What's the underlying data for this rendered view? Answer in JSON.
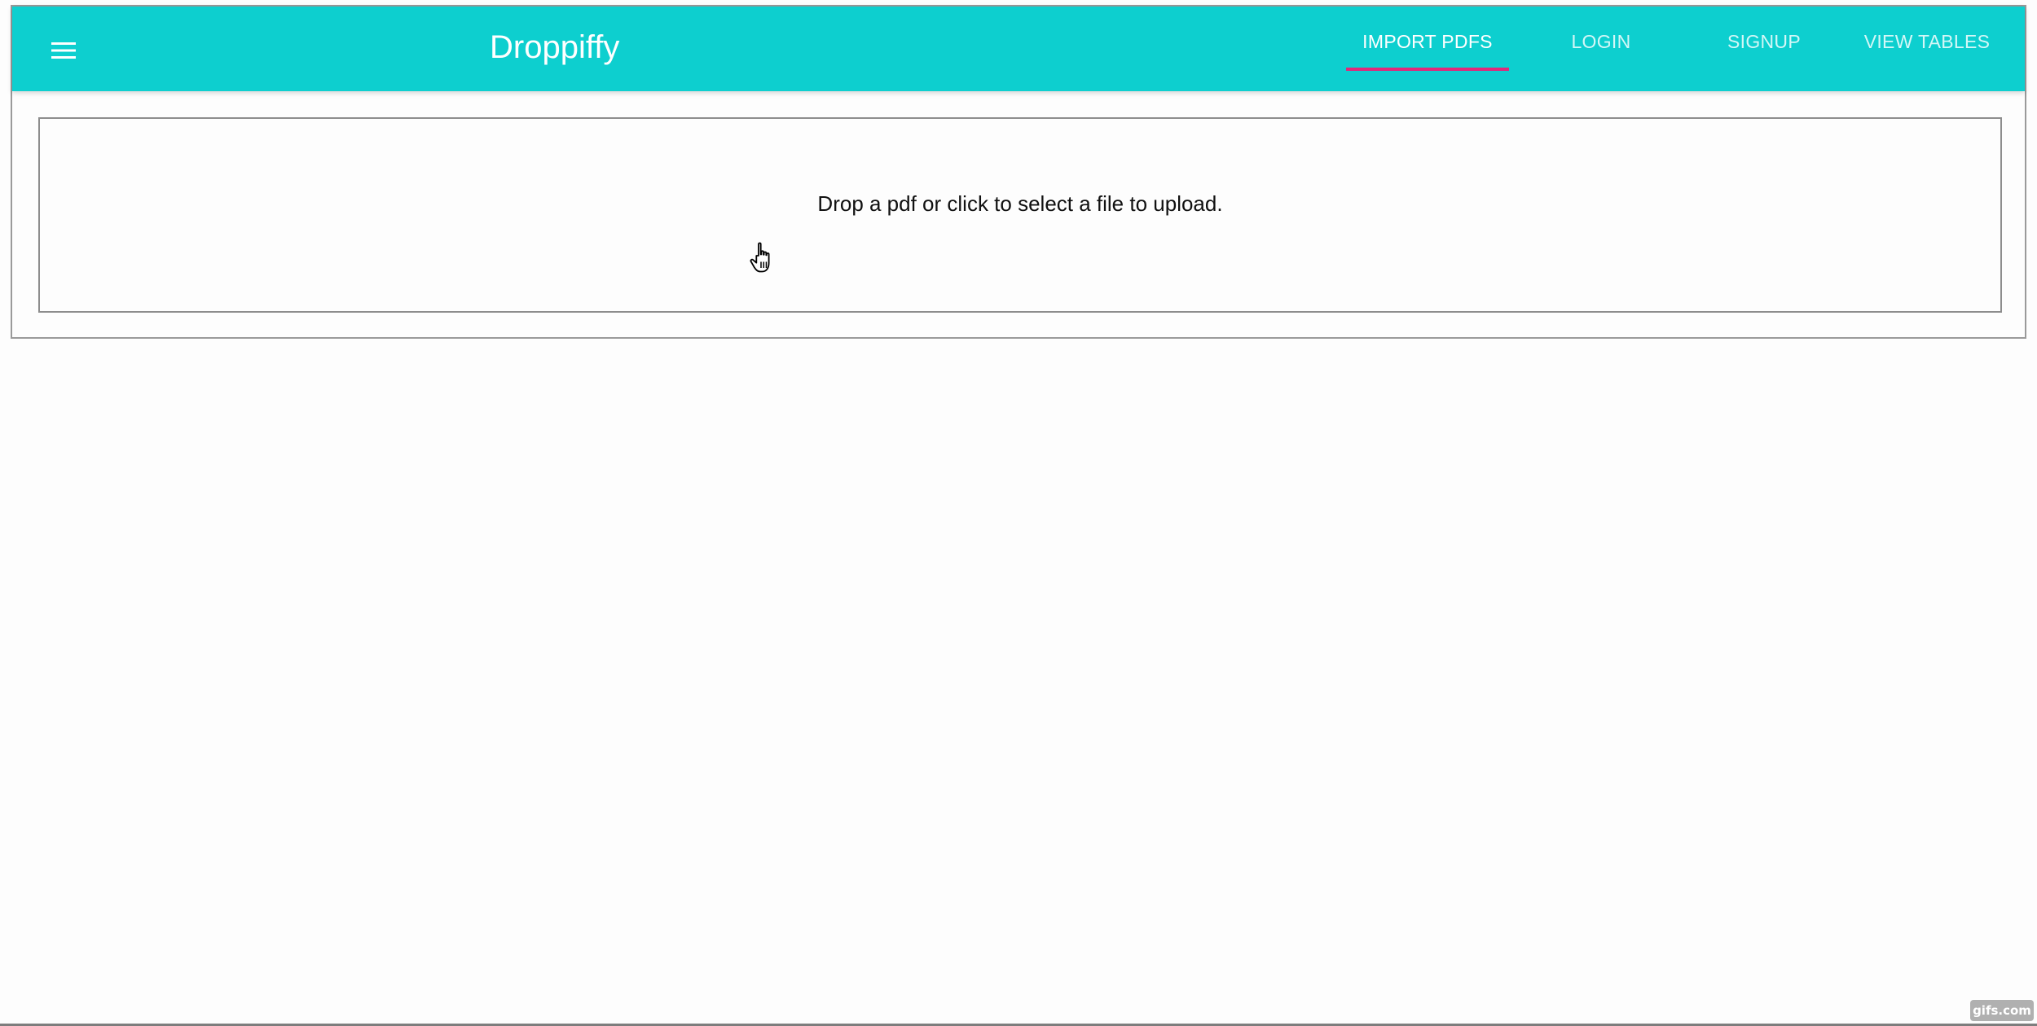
{
  "app": {
    "title": "Droppiffy"
  },
  "header": {
    "menu_icon": "hamburger-menu-icon",
    "tabs": [
      {
        "label": "IMPORT PDFS",
        "active": true
      },
      {
        "label": "LOGIN",
        "active": false
      },
      {
        "label": "SIGNUP",
        "active": false
      },
      {
        "label": "VIEW TABLES",
        "active": false
      }
    ]
  },
  "dropzone": {
    "prompt": "Drop a pdf or click to select a file to upload."
  },
  "cursor": {
    "icon": "hand-pointer-icon"
  },
  "watermark": {
    "text": "gifs.com"
  },
  "colors": {
    "app_bar": "#0dcfcf",
    "tab_indicator": "#e0287a",
    "background": "#fdfdfd",
    "text": "#111111"
  }
}
